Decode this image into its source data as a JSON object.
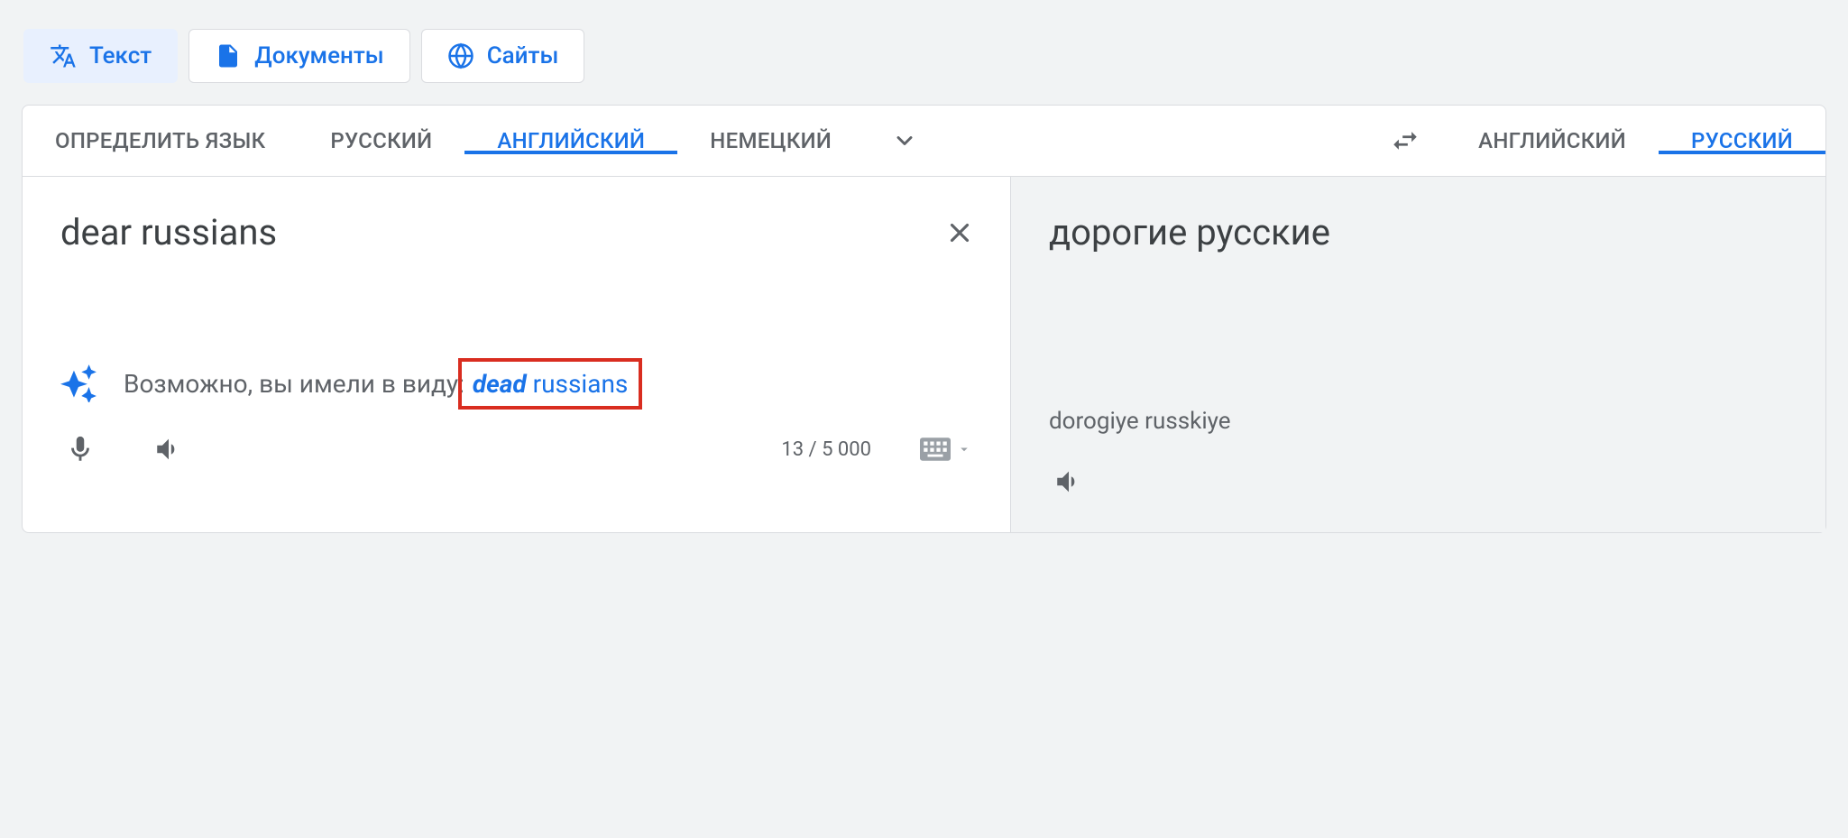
{
  "mode_tabs": {
    "text": "Текст",
    "documents": "Документы",
    "websites": "Сайты"
  },
  "source_lang_tabs": {
    "detect": "ОПРЕДЕЛИТЬ ЯЗЫК",
    "russian": "РУССКИЙ",
    "english": "АНГЛИЙСКИЙ",
    "german": "НЕМЕЦКИЙ"
  },
  "target_lang_tabs": {
    "english": "АНГЛИЙСКИЙ",
    "russian": "РУССКИЙ"
  },
  "source": {
    "text": "dear russians",
    "char_count": "13 / 5 000"
  },
  "suggestion": {
    "prefix": "Возможно, вы имели в виду:",
    "bold": "dead",
    "rest": " russians"
  },
  "target": {
    "text": "дорогие русские",
    "transliteration": "dorogiye russkiye"
  }
}
